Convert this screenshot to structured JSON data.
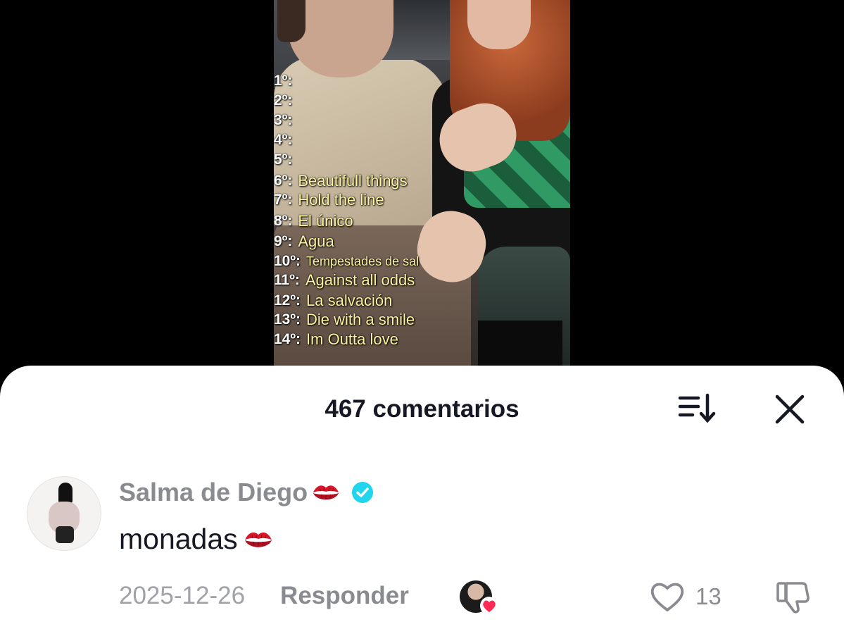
{
  "video": {
    "rankings": [
      {
        "num": "1º:",
        "song": ""
      },
      {
        "num": "2º:",
        "song": ""
      },
      {
        "num": "3º:",
        "song": ""
      },
      {
        "num": "4º:",
        "song": ""
      },
      {
        "num": "5º:",
        "song": ""
      },
      {
        "num": "6º:",
        "song": "Beautifull things"
      },
      {
        "num": "7º:",
        "song": "Hold the line"
      },
      {
        "num": "8º:",
        "song": "El único"
      },
      {
        "num": "9º:",
        "song": "Agua"
      },
      {
        "num": "10º:",
        "song": "Tempestades de sal"
      },
      {
        "num": "11º:",
        "song": "Against all odds"
      },
      {
        "num": "12º:",
        "song": "La salvación"
      },
      {
        "num": "13º:",
        "song": "Die with a smile"
      },
      {
        "num": "14º:",
        "song": "Im Outta love"
      }
    ]
  },
  "comments_sheet": {
    "title": "467 comentarios",
    "sort_icon": "sort-icon",
    "close_icon": "close-icon"
  },
  "comment": {
    "username": "Salma de Diego",
    "username_emoji": "kiss-mark",
    "verified_icon": "verified-badge-icon",
    "text": "monadas",
    "text_emoji": "kiss-mark",
    "date": "2025-12-26",
    "reply_label": "Responder",
    "like_count": "13",
    "like_icon": "heart-outline-icon",
    "dislike_icon": "thumbs-down-icon",
    "creator_liked_icon": "creator-heart-icon"
  },
  "colors": {
    "verified": "#20D5EC",
    "heart": "#FE2C55",
    "kiss": "#D8162B",
    "song_text": "#FBF3A0"
  }
}
